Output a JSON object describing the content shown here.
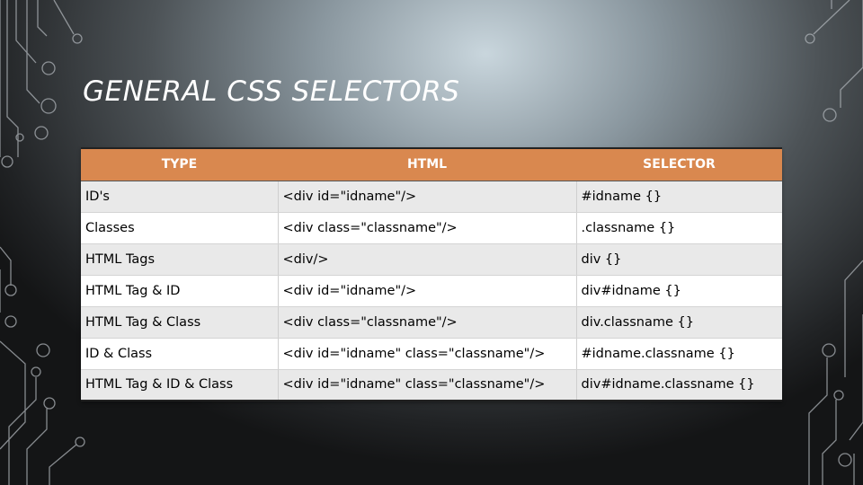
{
  "slide": {
    "title": "GENERAL CSS SELECTORS"
  },
  "table": {
    "headers": [
      "TYPE",
      "HTML",
      "SELECTOR"
    ],
    "rows": [
      {
        "type": "ID's",
        "html": "<div id=\"idname\"/>",
        "selector": "#idname {}"
      },
      {
        "type": "Classes",
        "html": "<div class=\"classname\"/>",
        "selector": ".classname {}"
      },
      {
        "type": "HTML Tags",
        "html": "<div/>",
        "selector": "div {}"
      },
      {
        "type": "HTML Tag & ID",
        "html": "<div id=\"idname\"/>",
        "selector": "div#idname {}"
      },
      {
        "type": "HTML Tag & Class",
        "html": "<div class=\"classname\"/>",
        "selector": "div.classname {}"
      },
      {
        "type": "ID & Class",
        "html": "<div id=\"idname\" class=\"classname\"/>",
        "selector": "#idname.classname {}"
      },
      {
        "type": "HTML Tag & ID & Class",
        "html": "<div id=\"idname\" class=\"classname\"/>",
        "selector": "div#idname.classname {}"
      }
    ]
  },
  "colors": {
    "header_fill": "#d9884f",
    "header_text": "#ffffff",
    "row_odd": "#e9e9e9",
    "row_even": "#ffffff",
    "circuit_lines": "#b8bcc0"
  }
}
